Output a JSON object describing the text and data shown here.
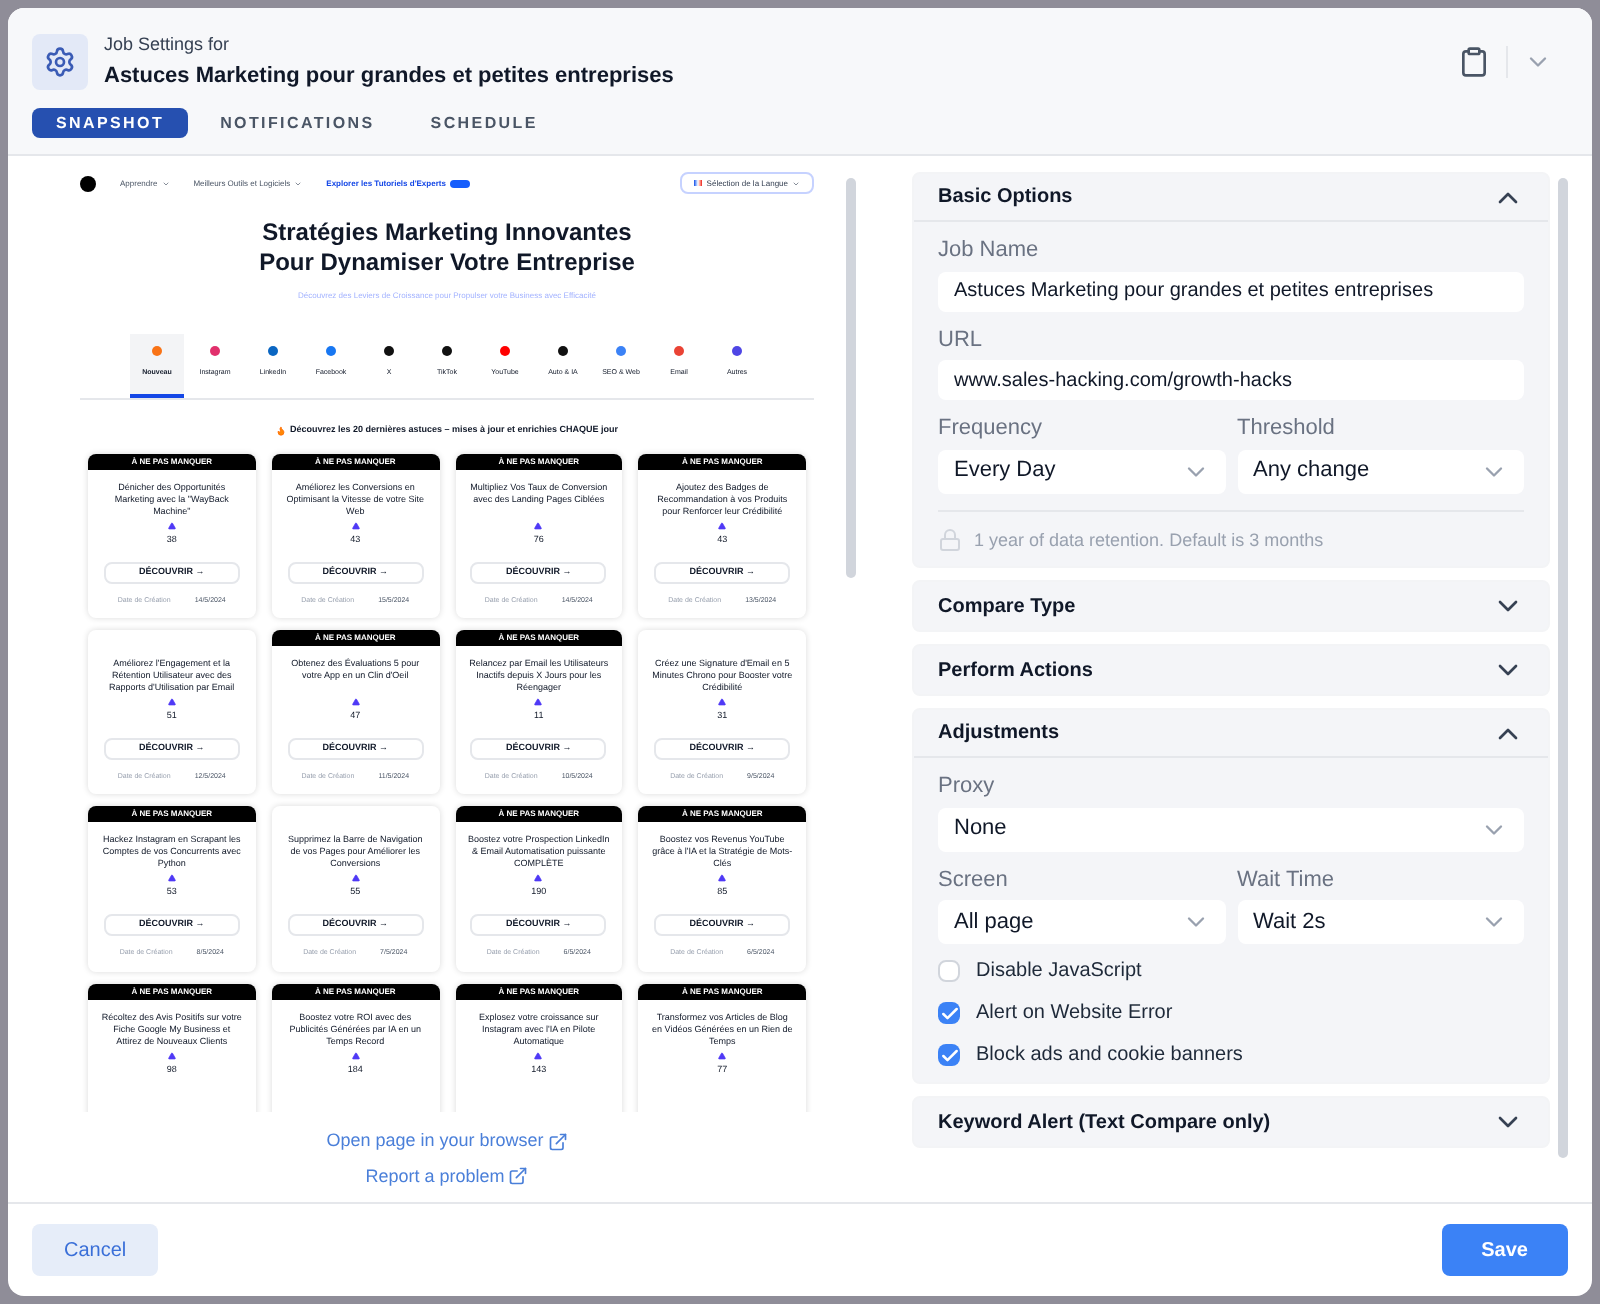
{
  "header": {
    "caption": "Job Settings for",
    "title": "Astuces Marketing pour grandes et petites entreprises"
  },
  "tabs": [
    {
      "label": "SNAPSHOT",
      "selected": true
    },
    {
      "label": "NOTIFICATIONS",
      "selected": false
    },
    {
      "label": "SCHEDULE",
      "selected": false
    }
  ],
  "snapshot": {
    "nav": [
      {
        "label": "Apprendre",
        "kind": "menu"
      },
      {
        "label": "Meilleurs Outils et Logiciels",
        "kind": "menu"
      },
      {
        "label": "Explorer les Tutoriels d'Experts",
        "kind": "highlight"
      }
    ],
    "language_button": "Sélection de la Langue",
    "heading": "Stratégies Marketing Innovantes Pour Dynamiser Votre Entreprise",
    "subheading": "Découvrez des Leviers de Croissance pour Propulser votre Business avec Efficacité",
    "categories": [
      {
        "label": "Nouveau",
        "selected": true,
        "color": "#f97316"
      },
      {
        "label": "Instagram",
        "selected": false,
        "color": "#e1306c"
      },
      {
        "label": "LinkedIn",
        "selected": false,
        "color": "#0a66c2"
      },
      {
        "label": "Facebook",
        "selected": false,
        "color": "#1877f2"
      },
      {
        "label": "X",
        "selected": false,
        "color": "#111111"
      },
      {
        "label": "TikTok",
        "selected": false,
        "color": "#111111"
      },
      {
        "label": "YouTube",
        "selected": false,
        "color": "#ff0000"
      },
      {
        "label": "Auto & IA",
        "selected": false,
        "color": "#111111"
      },
      {
        "label": "SEO & Web",
        "selected": false,
        "color": "#3b82f6"
      },
      {
        "label": "Email",
        "selected": false,
        "color": "#ea4335"
      },
      {
        "label": "Autres",
        "selected": false,
        "color": "#4f46e5"
      }
    ],
    "intro": "Découvrez les 20 dernières astuces – mises à jour et enrichies CHAQUE jour",
    "cards": [
      {
        "banner": "À NE PAS MANQUER",
        "text": "Dénicher des Opportunités Marketing avec la \"WayBack Machine\"",
        "votes": "38",
        "button": "DÉCOUVRIR →",
        "date_label": "Date de Création",
        "date": "14/5/2024"
      },
      {
        "banner": "À NE PAS MANQUER",
        "text": "Améliorez les Conversions en Optimisant la Vitesse de votre Site Web",
        "votes": "43",
        "button": "DÉCOUVRIR →",
        "date_label": "Date de Création",
        "date": "15/5/2024"
      },
      {
        "banner": "À NE PAS MANQUER",
        "text": "Multipliez Vos Taux de Conversion avec des Landing Pages Ciblées",
        "votes": "76",
        "button": "DÉCOUVRIR →",
        "date_label": "Date de Création",
        "date": "14/5/2024"
      },
      {
        "banner": "À NE PAS MANQUER",
        "text": "Ajoutez des Badges de Recommandation à vos Produits pour Renforcer leur Crédibilité",
        "votes": "43",
        "button": "DÉCOUVRIR →",
        "date_label": "Date de Création",
        "date": "13/5/2024"
      },
      {
        "text": "Améliorez l'Engagement et la Rétention Utilisateur avec des Rapports d'Utilisation par Email",
        "votes": "51",
        "button": "DÉCOUVRIR →",
        "date_label": "Date de Création",
        "date": "12/5/2024"
      },
      {
        "banner": "À NE PAS MANQUER",
        "text": "Obtenez des Évaluations 5 pour votre App en un Clin d'Oeil",
        "votes": "47",
        "button": "DÉCOUVRIR →",
        "date_label": "Date de Création",
        "date": "11/5/2024"
      },
      {
        "banner": "À NE PAS MANQUER",
        "text": "Relancez par Email les Utilisateurs Inactifs depuis X Jours pour les Réengager",
        "votes": "11",
        "button": "DÉCOUVRIR →",
        "date_label": "Date de Création",
        "date": "10/5/2024"
      },
      {
        "text": "Créez une Signature d'Email en 5 Minutes Chrono pour Booster votre Crédibilité",
        "votes": "31",
        "button": "DÉCOUVRIR →",
        "date_label": "Date de Création",
        "date": "9/5/2024"
      },
      {
        "banner": "À NE PAS MANQUER",
        "text": "Hackez Instagram en Scrapant les Comptes de vos Concurrents avec Python",
        "votes": "53",
        "button": "DÉCOUVRIR →",
        "date_label": "Date de Création",
        "date": "8/5/2024"
      },
      {
        "text": "Supprimez la Barre de Navigation de vos Pages pour Améliorer les Conversions",
        "votes": "55",
        "button": "DÉCOUVRIR →",
        "date_label": "Date de Création",
        "date": "7/5/2024"
      },
      {
        "banner": "À NE PAS MANQUER",
        "text": "Boostez votre Prospection LinkedIn & Email Automatisation puissante COMPLÈTE",
        "votes": "190",
        "button": "DÉCOUVRIR →",
        "date_label": "Date de Création",
        "date": "6/5/2024"
      },
      {
        "banner": "À NE PAS MANQUER",
        "text": "Boostez vos Revenus YouTube grâce à l'IA et la Stratégie de Mots-Clés",
        "votes": "85",
        "button": "DÉCOUVRIR →",
        "date_label": "Date de Création",
        "date": "6/5/2024"
      },
      {
        "banner": "À NE PAS MANQUER",
        "text": "Récoltez des Avis Positifs sur votre Fiche Google My Business et Attirez de Nouveaux Clients",
        "votes": "98"
      },
      {
        "banner": "À NE PAS MANQUER",
        "text": "Boostez votre ROI avec des Publicités Générées par IA en un Temps Record",
        "votes": "184"
      },
      {
        "banner": "À NE PAS MANQUER",
        "text": "Explosez votre croissance sur Instagram avec l'IA en Pilote Automatique",
        "votes": "143"
      },
      {
        "banner": "À NE PAS MANQUER",
        "text": "Transformez vos Articles de Blog en Vidéos Générées en un Rien de Temps",
        "votes": "77"
      }
    ]
  },
  "links": [
    "Open page in your browser",
    "Report a problem"
  ],
  "sections": [
    {
      "title": "Basic Options",
      "expanded": true,
      "fields": [
        {
          "kind": "text",
          "label": "Job Name",
          "value": "Astuces Marketing pour grandes et petites entreprises"
        },
        {
          "kind": "text",
          "label": "URL",
          "value": "www.sales-hacking.com/growth-hacks"
        },
        {
          "kind": "pair",
          "items": [
            {
              "label": "Frequency",
              "value": "Every Day"
            },
            {
              "label": "Threshold",
              "value": "Any change"
            }
          ]
        },
        {
          "kind": "note",
          "text": "1 year of data retention. Default is 3 months"
        }
      ]
    },
    {
      "title": "Compare Type",
      "expanded": false
    },
    {
      "title": "Perform Actions",
      "expanded": false
    },
    {
      "title": "Adjustments",
      "expanded": true,
      "fields": [
        {
          "kind": "select",
          "label": "Proxy",
          "value": "None"
        },
        {
          "kind": "pair",
          "items": [
            {
              "label": "Screen",
              "value": "All page"
            },
            {
              "label": "Wait Time",
              "value": "Wait 2s"
            }
          ]
        },
        {
          "kind": "checkbox",
          "label": "Disable JavaScript",
          "checked": false
        },
        {
          "kind": "checkbox",
          "label": "Alert on Website Error",
          "checked": true
        },
        {
          "kind": "checkbox",
          "label": "Block ads and cookie banners",
          "checked": true
        }
      ]
    },
    {
      "title": "Keyword Alert (Text Compare only)",
      "expanded": false
    }
  ],
  "footer": {
    "cancel": "Cancel",
    "save": "Save"
  }
}
